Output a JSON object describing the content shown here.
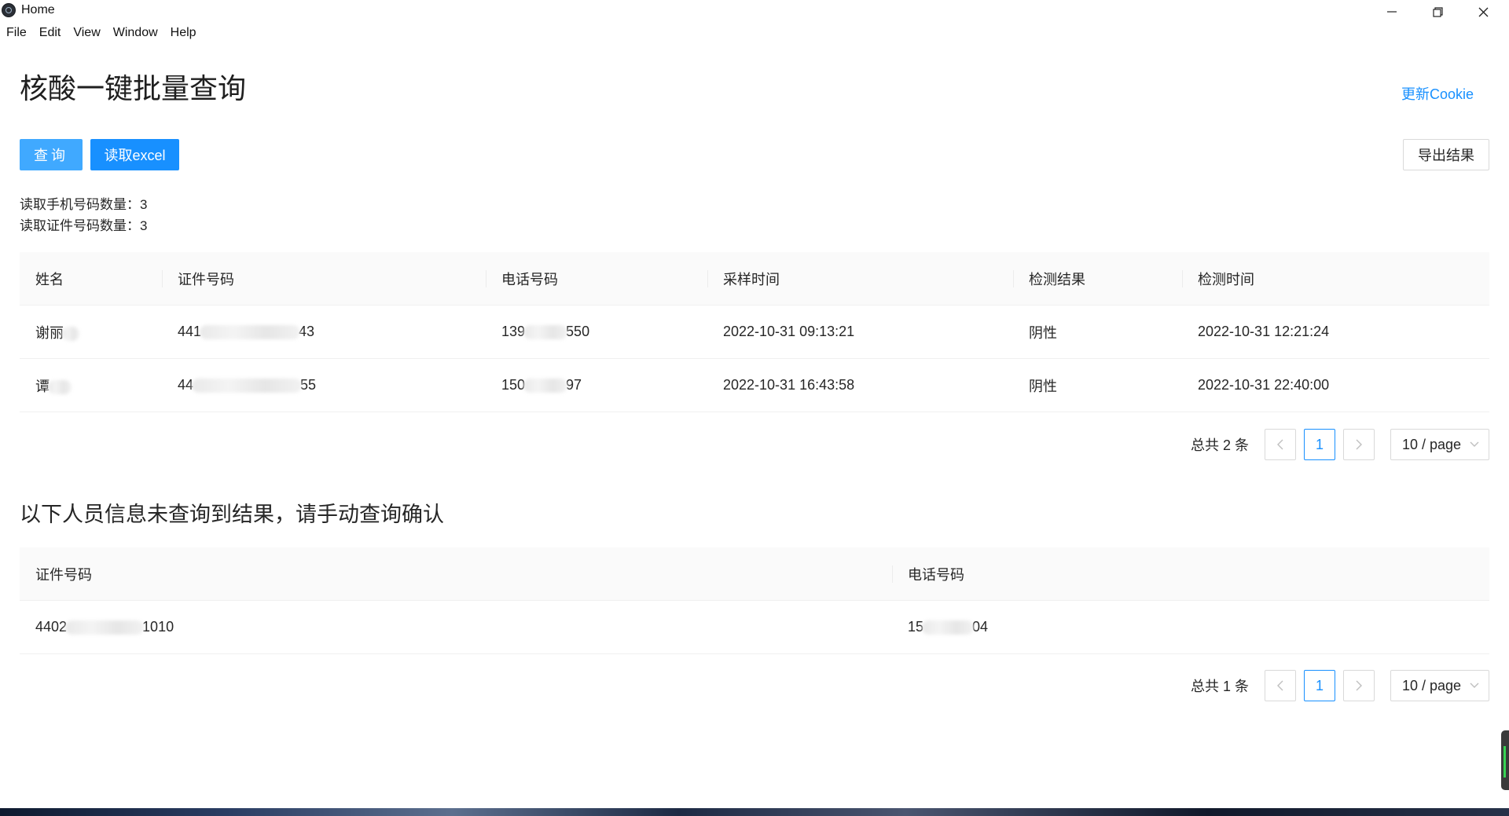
{
  "window": {
    "title": "Home",
    "menu": [
      "File",
      "Edit",
      "View",
      "Window",
      "Help"
    ]
  },
  "header": {
    "title": "核酸一键批量查询",
    "update_cookie": "更新Cookie"
  },
  "toolbar": {
    "query_label": "查询",
    "read_excel_label": "读取excel",
    "export_label": "导出结果"
  },
  "stats": {
    "phone_count": "读取手机号码数量：3",
    "id_count": "读取证件号码数量：3"
  },
  "results_table": {
    "columns": [
      "姓名",
      "证件号码",
      "电话号码",
      "采样时间",
      "检测结果",
      "检测时间"
    ],
    "rows": [
      {
        "name": "谢丽",
        "id_prefix": "441",
        "id_suffix": "43",
        "phone_prefix": "139",
        "phone_suffix": "550",
        "sample_time": "2022-10-31 09:13:21",
        "result": "阴性",
        "test_time": "2022-10-31 12:21:24"
      },
      {
        "name": "谭",
        "id_prefix": "44",
        "id_suffix": "55",
        "phone_prefix": "150",
        "phone_suffix": "97",
        "sample_time": "2022-10-31 16:43:58",
        "result": "阴性",
        "test_time": "2022-10-31 22:40:00"
      }
    ],
    "pagination": {
      "total": "总共 2 条",
      "current_page": "1",
      "page_size": "10 / page"
    }
  },
  "missing": {
    "title": "以下人员信息未查询到结果，请手动查询确认",
    "columns": [
      "证件号码",
      "电话号码"
    ],
    "rows": [
      {
        "id_prefix": "4402",
        "id_suffix": "1010",
        "phone_prefix": "15",
        "phone_suffix": "04"
      }
    ],
    "pagination": {
      "total": "总共 1 条",
      "current_page": "1",
      "page_size": "10 / page"
    }
  },
  "colors": {
    "primary": "#1890ff",
    "primary_light": "#40a9ff",
    "border": "#d9d9d9",
    "header_bg": "#fafafa"
  }
}
